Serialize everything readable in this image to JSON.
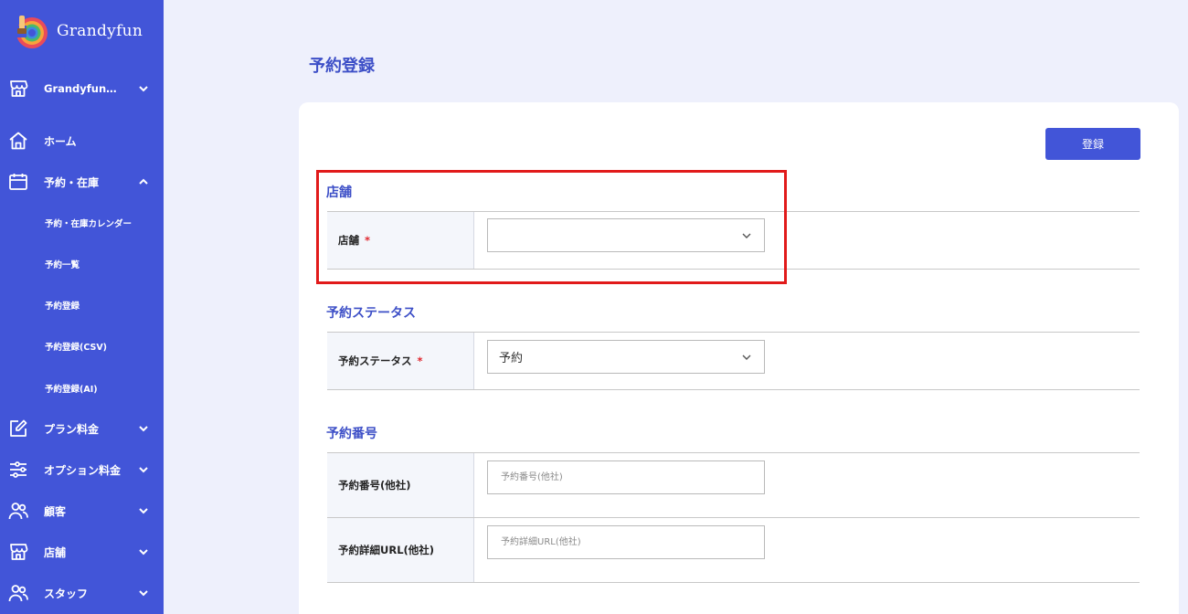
{
  "app": {
    "name": "Grandyfun"
  },
  "sidebar": {
    "store_selector": {
      "label": "Grandyfun…",
      "icon": "store-icon"
    },
    "items": [
      {
        "label": "ホーム",
        "icon": "home-icon"
      },
      {
        "label": "予約・在庫",
        "icon": "calendar-icon",
        "expanded": true,
        "children": [
          {
            "label": "予約・在庫カレンダー"
          },
          {
            "label": "予約一覧"
          },
          {
            "label": "予約登録"
          },
          {
            "label": "予約登録(CSV)"
          },
          {
            "label": "予約登録(AI)"
          }
        ]
      },
      {
        "label": "プラン料金",
        "icon": "edit-icon"
      },
      {
        "label": "オプション料金",
        "icon": "sliders-icon"
      },
      {
        "label": "顧客",
        "icon": "people-icon"
      },
      {
        "label": "店舗",
        "icon": "store-icon"
      },
      {
        "label": "スタッフ",
        "icon": "people-icon"
      }
    ]
  },
  "main": {
    "title": "予約登録",
    "register_button": "登録",
    "sections": [
      {
        "title": "店舗",
        "fields": [
          {
            "label": "店舗",
            "required_mark": "*",
            "type": "select",
            "value": ""
          }
        ]
      },
      {
        "title": "予約ステータス",
        "fields": [
          {
            "label": "予約ステータス",
            "required_mark": "*",
            "type": "select",
            "value": "予約"
          }
        ]
      },
      {
        "title": "予約番号",
        "fields": [
          {
            "label": "予約番号(他社)",
            "type": "text",
            "value": "",
            "placeholder": "予約番号(他社)"
          },
          {
            "label": "予約詳細URL(他社)",
            "type": "text",
            "value": "",
            "placeholder": "予約詳細URL(他社)"
          }
        ]
      }
    ]
  },
  "colors": {
    "sidebar_bg": "#4255d8",
    "accent": "#3d4fc7",
    "button_bg": "#4255d8",
    "required": "#e0262d",
    "highlight": "#e11a1a",
    "page_bg": "#eef0fc"
  }
}
